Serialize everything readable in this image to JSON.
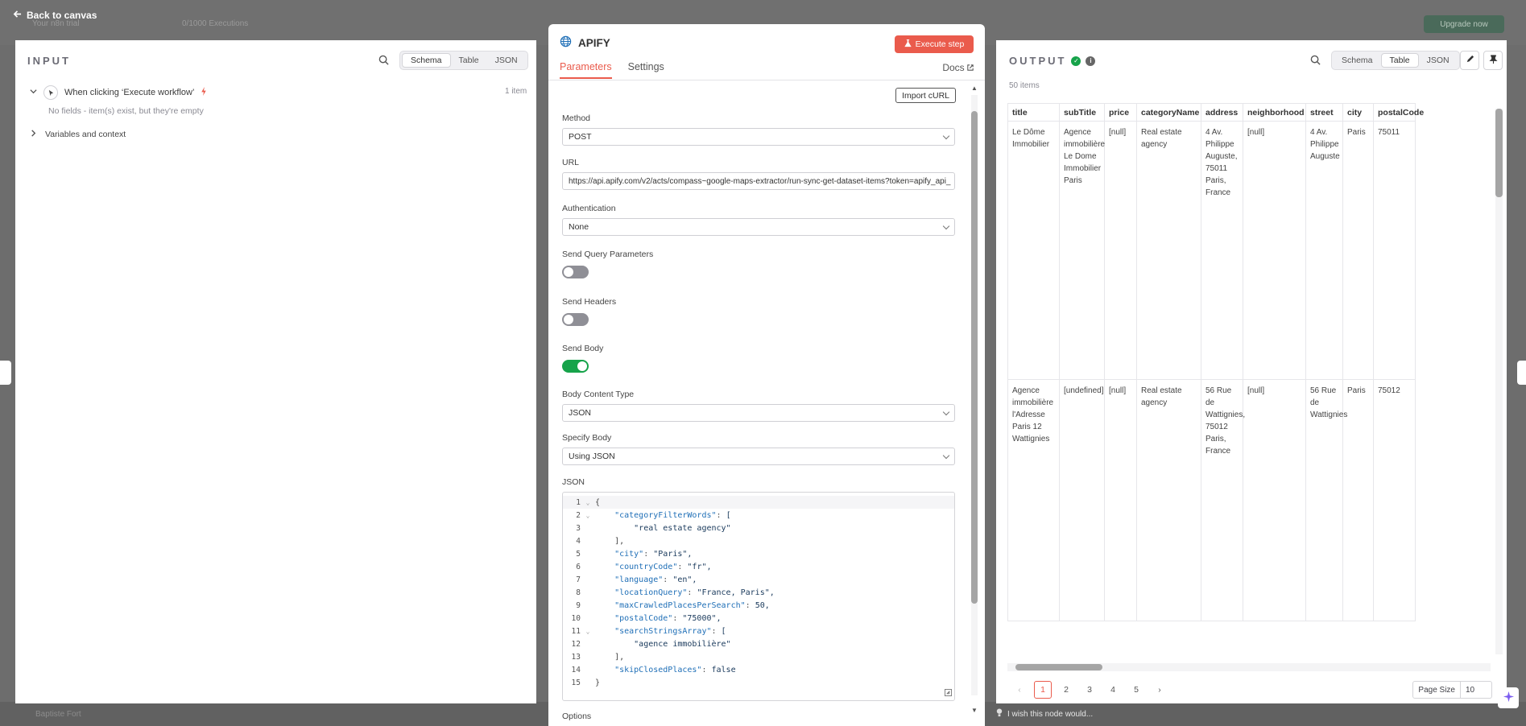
{
  "background": {
    "back_label": "Back to canvas",
    "trial_text": "Your n8n trial",
    "executions_text": "0/1000 Executions",
    "upgrade_label": "Upgrade now",
    "user_name": "Baptiste Fort"
  },
  "input": {
    "title": "INPUT",
    "view_tabs": [
      "Schema",
      "Table",
      "JSON"
    ],
    "active_tab": "Schema",
    "trigger_label": "When clicking ‘Execute workflow’",
    "item_count": "1 item",
    "empty_note": "No fields - item(s) exist, but they're empty",
    "variables_label": "Variables and context"
  },
  "node": {
    "name": "APIFY",
    "execute_label": "Execute step",
    "tabs": [
      "Parameters",
      "Settings"
    ],
    "active_tab": "Parameters",
    "docs_label": "Docs",
    "import_curl_label": "Import cURL",
    "method_label": "Method",
    "method_value": "POST",
    "url_label": "URL",
    "url_value": "https://api.apify.com/v2/acts/compass~google-maps-extractor/run-sync-get-dataset-items?token=apify_api_",
    "auth_label": "Authentication",
    "auth_value": "None",
    "send_query_label": "Send Query Parameters",
    "send_query_on": false,
    "send_headers_label": "Send Headers",
    "send_headers_on": false,
    "send_body_label": "Send Body",
    "send_body_on": true,
    "body_type_label": "Body Content Type",
    "body_type_value": "JSON",
    "specify_body_label": "Specify Body",
    "specify_body_value": "Using JSON",
    "json_label": "JSON",
    "options_label": "Options",
    "code_lines": [
      "{",
      "    \"categoryFilterWords\": [",
      "        \"real estate agency\"",
      "    ],",
      "    \"city\": \"Paris\",",
      "    \"countryCode\": \"fr\",",
      "    \"language\": \"en\",",
      "    \"locationQuery\": \"France, Paris\",",
      "    \"maxCrawledPlacesPerSearch\": 50,",
      "    \"postalCode\": \"75000\",",
      "    \"searchStringsArray\": [",
      "        \"agence immobilière\"",
      "    ],",
      "    \"skipClosedPlaces\": false",
      "}"
    ]
  },
  "output": {
    "title": "OUTPUT",
    "items_count": "50 items",
    "view_tabs": [
      "Schema",
      "Table",
      "JSON"
    ],
    "active_tab": "Table",
    "columns": [
      "title",
      "subTitle",
      "price",
      "categoryName",
      "address",
      "neighborhood",
      "street",
      "city",
      "postalCode"
    ],
    "rows": [
      [
        "Le Dôme Immobilier",
        "Agence immobilière Le Dome Immobilier Paris",
        "[null]",
        "Real estate agency",
        "4 Av. Philippe Auguste, 75011 Paris, France",
        "[null]",
        "4 Av. Philippe Auguste",
        "Paris",
        "75011"
      ],
      [
        "Agence immobilière l'Adresse Paris 12 Wattignies",
        "[undefined]",
        "[null]",
        "Real estate agency",
        "56 Rue de Wattignies, 75012 Paris, France",
        "[null]",
        "56 Rue de Wattignies",
        "Paris",
        "75012"
      ]
    ],
    "pages": [
      "1",
      "2",
      "3",
      "4",
      "5"
    ],
    "active_page": "1",
    "page_size_label": "Page Size",
    "page_size_value": "10",
    "wish_text": "I wish this node would..."
  },
  "colors": {
    "accent": "#ea5b4c",
    "success": "#16a34a"
  }
}
